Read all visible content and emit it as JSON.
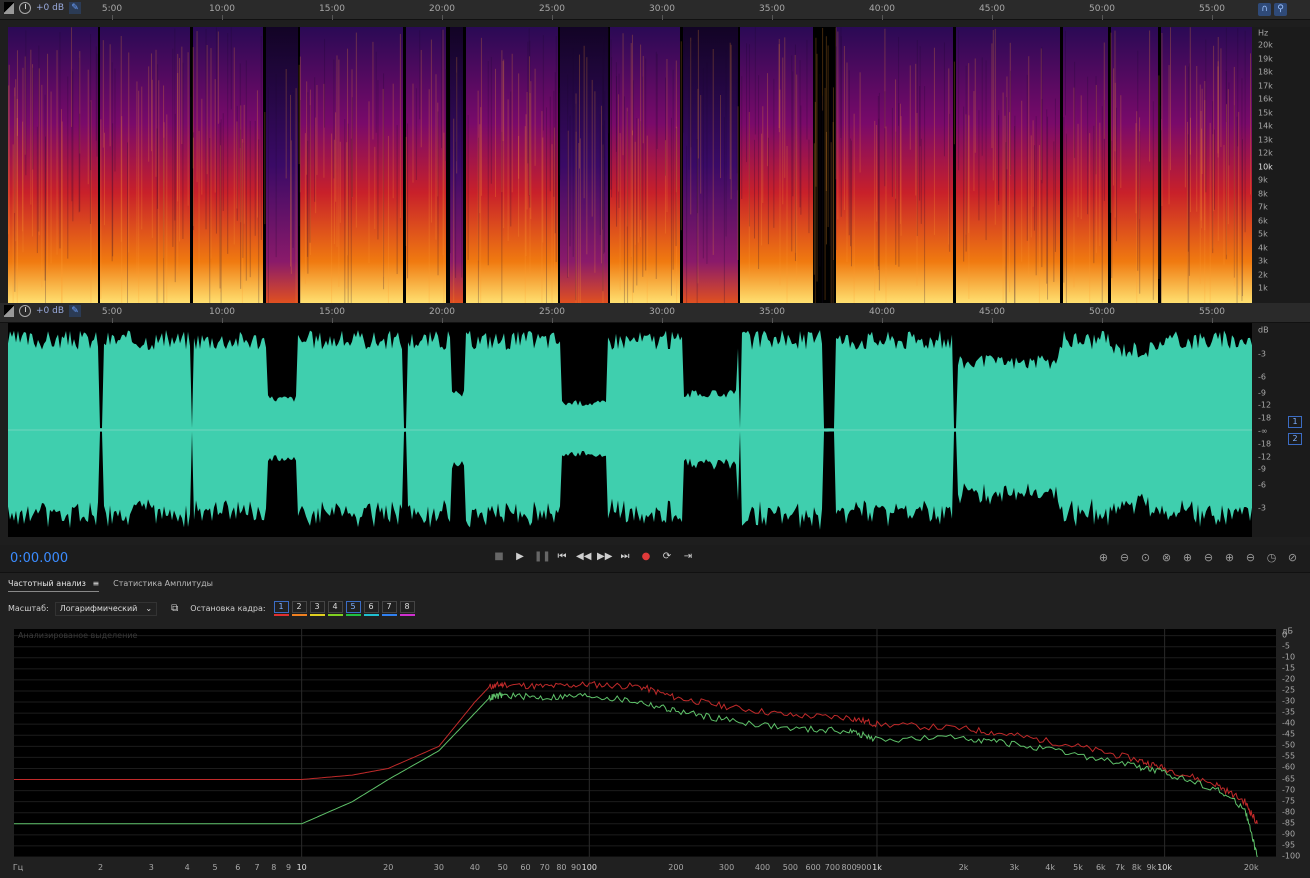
{
  "ruler": {
    "gain_label": "+0 dB",
    "ticks": [
      "5:00",
      "10:00",
      "15:00",
      "20:00",
      "25:00",
      "30:00",
      "35:00",
      "40:00",
      "45:00",
      "50:00",
      "55:00"
    ]
  },
  "spectral": {
    "unit": "Hz",
    "labels": [
      "20k",
      "19k",
      "18k",
      "17k",
      "16k",
      "15k",
      "14k",
      "13k",
      "12k",
      "10k",
      "9k",
      "8k",
      "7k",
      "6k",
      "5k",
      "4k",
      "3k",
      "2k",
      "1k"
    ]
  },
  "waveform": {
    "unit": "dB",
    "labels": [
      "-3",
      "-6",
      "-9",
      "-12",
      "-18",
      "-∞",
      "-18",
      "-12",
      "-9",
      "-6",
      "-3"
    ],
    "channels": [
      "1",
      "2"
    ]
  },
  "transport": {
    "time": "0:00.000",
    "buttons": [
      "stop-icon",
      "play-icon",
      "pause-icon",
      "skip-start-icon",
      "rewind-icon",
      "fast-forward-icon",
      "skip-end-icon",
      "record-icon",
      "loop-icon",
      "skip-selection-icon"
    ]
  },
  "zoom_buttons": [
    "zoom-in-amplitude-icon",
    "zoom-out-amplitude-icon",
    "zoom-fit-icon",
    "zoom-reset-icon",
    "zoom-in-icon",
    "zoom-out-icon",
    "zoom-in-selection-icon",
    "zoom-out-full-icon",
    "zoom-clock-icon",
    "zoom-extra-icon"
  ],
  "panel": {
    "tab_freq": "Частотный анализ",
    "tab_amp": "Статистика Амплитуды",
    "scale_label": "Масштаб:",
    "scale_value": "Логарифмический",
    "freeze_label": "Остановка кадра:",
    "frames": [
      {
        "n": "1",
        "color": "#e03030"
      },
      {
        "n": "2",
        "color": "#f08020"
      },
      {
        "n": "3",
        "color": "#e0d020"
      },
      {
        "n": "4",
        "color": "#80d020"
      },
      {
        "n": "5",
        "color": "#20c040"
      },
      {
        "n": "6",
        "color": "#20c0d0"
      },
      {
        "n": "7",
        "color": "#3080f0"
      },
      {
        "n": "8",
        "color": "#d030d0"
      }
    ],
    "analyzed_label": "Анализированое выделение"
  },
  "chart_data": {
    "type": "line",
    "xlabel": "Гц",
    "ylabel": "дБ",
    "x_scale": "log",
    "xlim": [
      1,
      24000
    ],
    "ylim": [
      -100,
      3
    ],
    "x_tick_labels": [
      "Гц",
      "2",
      "3",
      "4",
      "5",
      "6",
      "7",
      "8",
      "9",
      "10",
      "20",
      "30",
      "40",
      "50",
      "60",
      "70",
      "80",
      "90",
      "100",
      "200",
      "300",
      "400",
      "500",
      "600",
      "700",
      "800",
      "900",
      "1k",
      "2k",
      "3k",
      "4k",
      "5k",
      "6k",
      "7k",
      "8k",
      "9k",
      "10k",
      "20k"
    ],
    "y_tick_labels": [
      "дБ",
      "0",
      "-5",
      "-10",
      "-15",
      "-20",
      "-25",
      "-30",
      "-35",
      "-40",
      "-45",
      "-50",
      "-55",
      "-60",
      "-65",
      "-70",
      "-75",
      "-80",
      "-85",
      "-90",
      "-95",
      "-100"
    ],
    "series": [
      {
        "color": "#c02a2a",
        "x": [
          1,
          5,
          10,
          15,
          20,
          30,
          40,
          45,
          50,
          70,
          100,
          150,
          200,
          300,
          500,
          800,
          1000,
          2000,
          3000,
          5000,
          8000,
          10000,
          15000,
          19000,
          21000
        ],
        "y": [
          -65,
          -65,
          -65,
          -63,
          -60,
          -50,
          -30,
          -23,
          -22,
          -23,
          -22,
          -23,
          -28,
          -32,
          -36,
          -37,
          -40,
          -42,
          -45,
          -50,
          -56,
          -60,
          -67,
          -75,
          -85
        ]
      },
      {
        "color": "#5fc26a",
        "x": [
          1,
          5,
          10,
          15,
          20,
          30,
          40,
          45,
          50,
          70,
          100,
          150,
          200,
          300,
          500,
          800,
          1000,
          2000,
          3000,
          5000,
          8000,
          10000,
          15000,
          19000,
          21000
        ],
        "y": [
          -85,
          -85,
          -85,
          -75,
          -65,
          -52,
          -35,
          -28,
          -27,
          -28,
          -27,
          -30,
          -34,
          -38,
          -42,
          -43,
          -47,
          -46,
          -49,
          -54,
          -59,
          -62,
          -69,
          -78,
          -100
        ]
      }
    ]
  }
}
